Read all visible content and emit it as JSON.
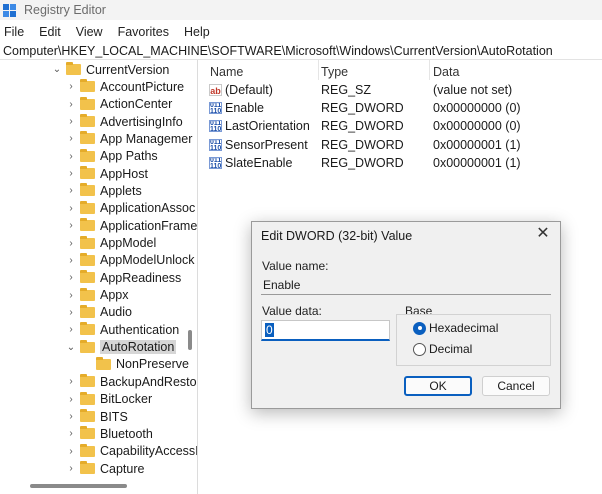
{
  "window": {
    "title": "Registry Editor",
    "icon": "registry-editor-icon"
  },
  "menu": [
    "File",
    "Edit",
    "View",
    "Favorites",
    "Help"
  ],
  "address": "Computer\\HKEY_LOCAL_MACHINE\\SOFTWARE\\Microsoft\\Windows\\CurrentVersion\\AutoRotation",
  "tree": {
    "parent": "CurrentVersion",
    "items": [
      "AccountPicture",
      "ActionCenter",
      "AdvertisingInfo",
      "App Managemer",
      "App Paths",
      "AppHost",
      "Applets",
      "ApplicationAssoc",
      "ApplicationFrame",
      "AppModel",
      "AppModelUnlock",
      "AppReadiness",
      "Appx",
      "Audio",
      "Authentication",
      "AutoRotation"
    ],
    "selected_child": "NonPreserve",
    "items_after": [
      "BackupAndResto",
      "BitLocker",
      "BITS",
      "Bluetooth",
      "CapabilityAccessI",
      "Capture"
    ]
  },
  "columns": {
    "name": "Name",
    "type": "Type",
    "data": "Data"
  },
  "values": [
    {
      "name": "(Default)",
      "type": "REG_SZ",
      "data": "(value not set)",
      "icon": "string-value-icon"
    },
    {
      "name": "Enable",
      "type": "REG_DWORD",
      "data": "0x00000000 (0)",
      "icon": "binary-value-icon"
    },
    {
      "name": "LastOrientation",
      "type": "REG_DWORD",
      "data": "0x00000000 (0)",
      "icon": "binary-value-icon"
    },
    {
      "name": "SensorPresent",
      "type": "REG_DWORD",
      "data": "0x00000001 (1)",
      "icon": "binary-value-icon"
    },
    {
      "name": "SlateEnable",
      "type": "REG_DWORD",
      "data": "0x00000001 (1)",
      "icon": "binary-value-icon"
    }
  ],
  "dialog": {
    "title": "Edit DWORD (32-bit) Value",
    "value_name_label": "Value name:",
    "value_name": "Enable",
    "value_data_label": "Value data:",
    "value_data": "0",
    "base_label": "Base",
    "base_options": [
      "Hexadecimal",
      "Decimal"
    ],
    "base_selected": "Hexadecimal",
    "ok": "OK",
    "cancel": "Cancel"
  },
  "ab_glyph": "ab",
  "bin_glyph": "011 110",
  "close_glyph": "✕",
  "chev_right": "›",
  "chev_down": "⌄"
}
